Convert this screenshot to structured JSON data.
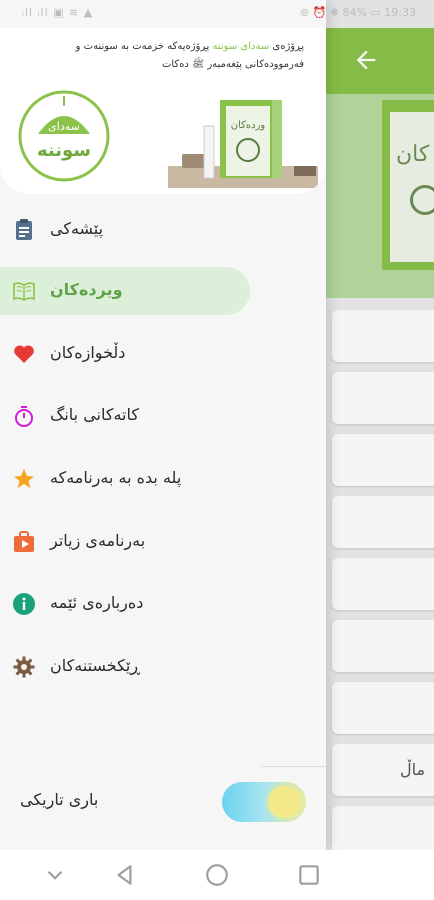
{
  "status_bar": {
    "left": "ᵢll ᵢll  ▣ ≋ ▲",
    "right": "⊚ ⏰ ✱ 84% ▭ 19:33"
  },
  "header": {
    "tagline_part1": "پڕۆژەی ",
    "tagline_brand": "سەدای سوننە",
    "tagline_part2": " پڕۆژەیەکە خزمەت بە سوننەت و فەرموودەکانی پێغەمبەر ﷺ دەکات",
    "logo_top": "سەدای",
    "logo_main": "سوننە",
    "book_title": "وردەکان"
  },
  "menu": {
    "items": [
      {
        "label": "پێشەکی",
        "icon": "clipboard-icon",
        "color": "#55708a"
      },
      {
        "label": "ویردەکان",
        "icon": "open-book-icon",
        "color": "#8bc34a",
        "selected": true
      },
      {
        "label": "دڵخوازەکان",
        "icon": "heart-icon",
        "color": "#e53935"
      },
      {
        "label": "کاتەکانی بانگ",
        "icon": "timer-icon",
        "color": "#d81bd8"
      },
      {
        "label": "پلە بدە بە بەرنامەکە",
        "icon": "star-icon",
        "color": "#f5a623"
      },
      {
        "label": "بەرنامەی زیاتر",
        "icon": "play-bag-icon",
        "color": "#f06a3a"
      },
      {
        "label": "دەربارەی ئێمە",
        "icon": "info-icon",
        "color": "#1aa37a"
      },
      {
        "label": "ڕێکخستنەکان",
        "icon": "gear-icon",
        "color": "#7a5c45"
      }
    ]
  },
  "dark_mode": {
    "label": "باری تاریکی"
  },
  "background": {
    "card_label": "ماڵ",
    "book_text": "کان"
  },
  "colors": {
    "accent": "#8bc34a",
    "selected_bg": "#dcefd9"
  }
}
